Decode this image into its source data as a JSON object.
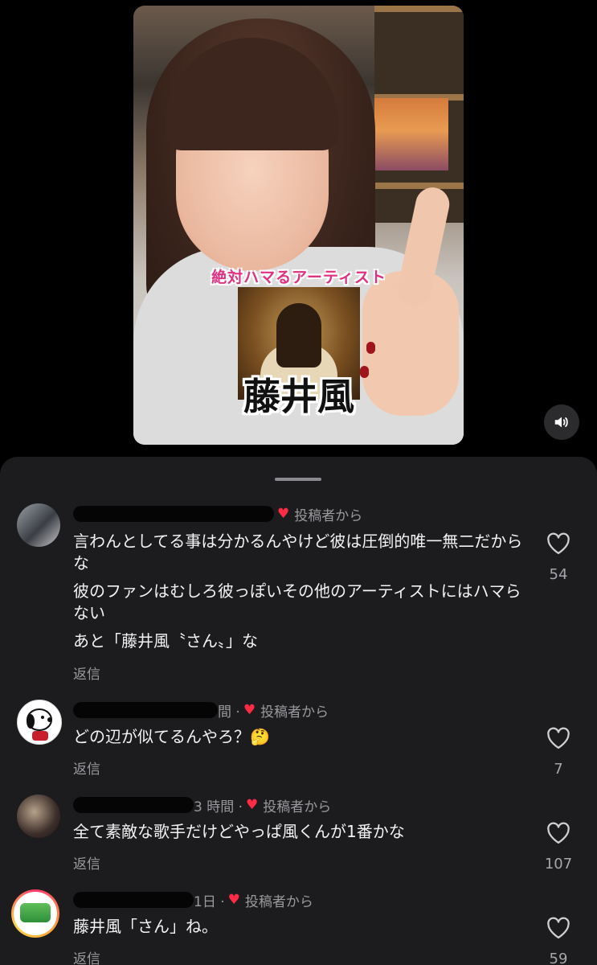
{
  "video": {
    "caption_top": "絶対ハマるアーティスト",
    "caption_name": "藤井風",
    "volume_icon": "speaker-icon"
  },
  "comments": [
    {
      "author_suffix": "",
      "creator_badge": "投稿者から",
      "lines": [
        "言わんとしてる事は分かるんやけど彼は圧倒的唯一無二だからな",
        "彼のファンはむしろ彼っぽいその他のアーティストにはハマらない",
        "あと「藤井風〝さん〟」な"
      ],
      "reply": "返信",
      "likes": "54"
    },
    {
      "author_suffix": "間 ·",
      "creator_badge": "投稿者から",
      "lines": [
        "どの辺が似てるんやろ？🤔"
      ],
      "reply": "返信",
      "likes": "7"
    },
    {
      "author_suffix": "3 時間 ·",
      "creator_badge": "投稿者から",
      "lines": [
        "全て素敵な歌手だけどやっぱ風くんが1番かな"
      ],
      "reply": "返信",
      "likes": "107"
    },
    {
      "author_suffix": "1日 ·",
      "creator_badge": "投稿者から",
      "lines": [
        "藤井風「さん」ね。"
      ],
      "reply": "返信",
      "likes": "59"
    }
  ],
  "colors": {
    "sheet_bg": "#1c1c1e",
    "accent_heart": "#ff2b45",
    "caption_pink": "#e0307f"
  }
}
